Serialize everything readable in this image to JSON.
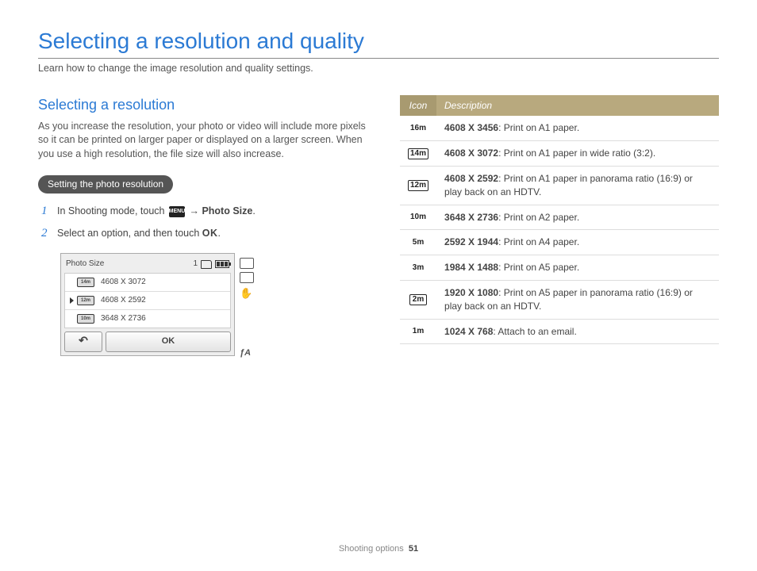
{
  "title": "Selecting a resolution and quality",
  "subtitle": "Learn how to change the image resolution and quality settings.",
  "section": {
    "heading": "Selecting a resolution",
    "body": "As you increase the resolution, your photo or video will include more pixels so it can be printed on larger paper or displayed on a larger screen. When you use a high resolution, the file size will also increase.",
    "pill": "Setting the photo resolution"
  },
  "steps": [
    {
      "n": "1",
      "pre": "In Shooting mode, touch ",
      "menu": "MENU",
      "arrow": " → ",
      "bold": "Photo Size",
      "post": "."
    },
    {
      "n": "2",
      "pre": "Select an option, and then touch ",
      "ok": "OK",
      "post": "."
    }
  ],
  "lcd": {
    "title": "Photo Size",
    "count": "1",
    "rows": [
      {
        "icon": "14m",
        "label": "4608 X 3072"
      },
      {
        "icon": "12m",
        "label": "4608 X 2592"
      },
      {
        "icon": "10m",
        "label": "3648 X 2736"
      }
    ],
    "back": "↶",
    "ok": "OK",
    "flash": "ƒA"
  },
  "table": {
    "head_icon": "Icon",
    "head_desc": "Description",
    "rows": [
      {
        "icon": "16m",
        "boxed": false,
        "res": "4608 X 3456",
        "desc": ": Print on A1 paper."
      },
      {
        "icon": "14m",
        "boxed": true,
        "res": "4608 X 3072",
        "desc": ": Print on A1 paper in wide ratio (3:2)."
      },
      {
        "icon": "12m",
        "boxed": true,
        "res": "4608 X 2592",
        "desc": ": Print on A1 paper in panorama ratio (16:9) or play back on an HDTV."
      },
      {
        "icon": "10m",
        "boxed": false,
        "res": "3648 X 2736",
        "desc": ": Print on A2 paper."
      },
      {
        "icon": "5m",
        "boxed": false,
        "res": "2592 X 1944",
        "desc": ": Print on A4 paper."
      },
      {
        "icon": "3m",
        "boxed": false,
        "res": "1984 X 1488",
        "desc": ": Print on A5 paper."
      },
      {
        "icon": "2m",
        "boxed": true,
        "res": "1920 X 1080",
        "desc": ": Print on A5 paper in panorama ratio (16:9) or play back on an HDTV."
      },
      {
        "icon": "1m",
        "boxed": false,
        "res": "1024 X 768",
        "desc": ": Attach to an email."
      }
    ]
  },
  "footer": {
    "section": "Shooting options",
    "page": "51"
  }
}
